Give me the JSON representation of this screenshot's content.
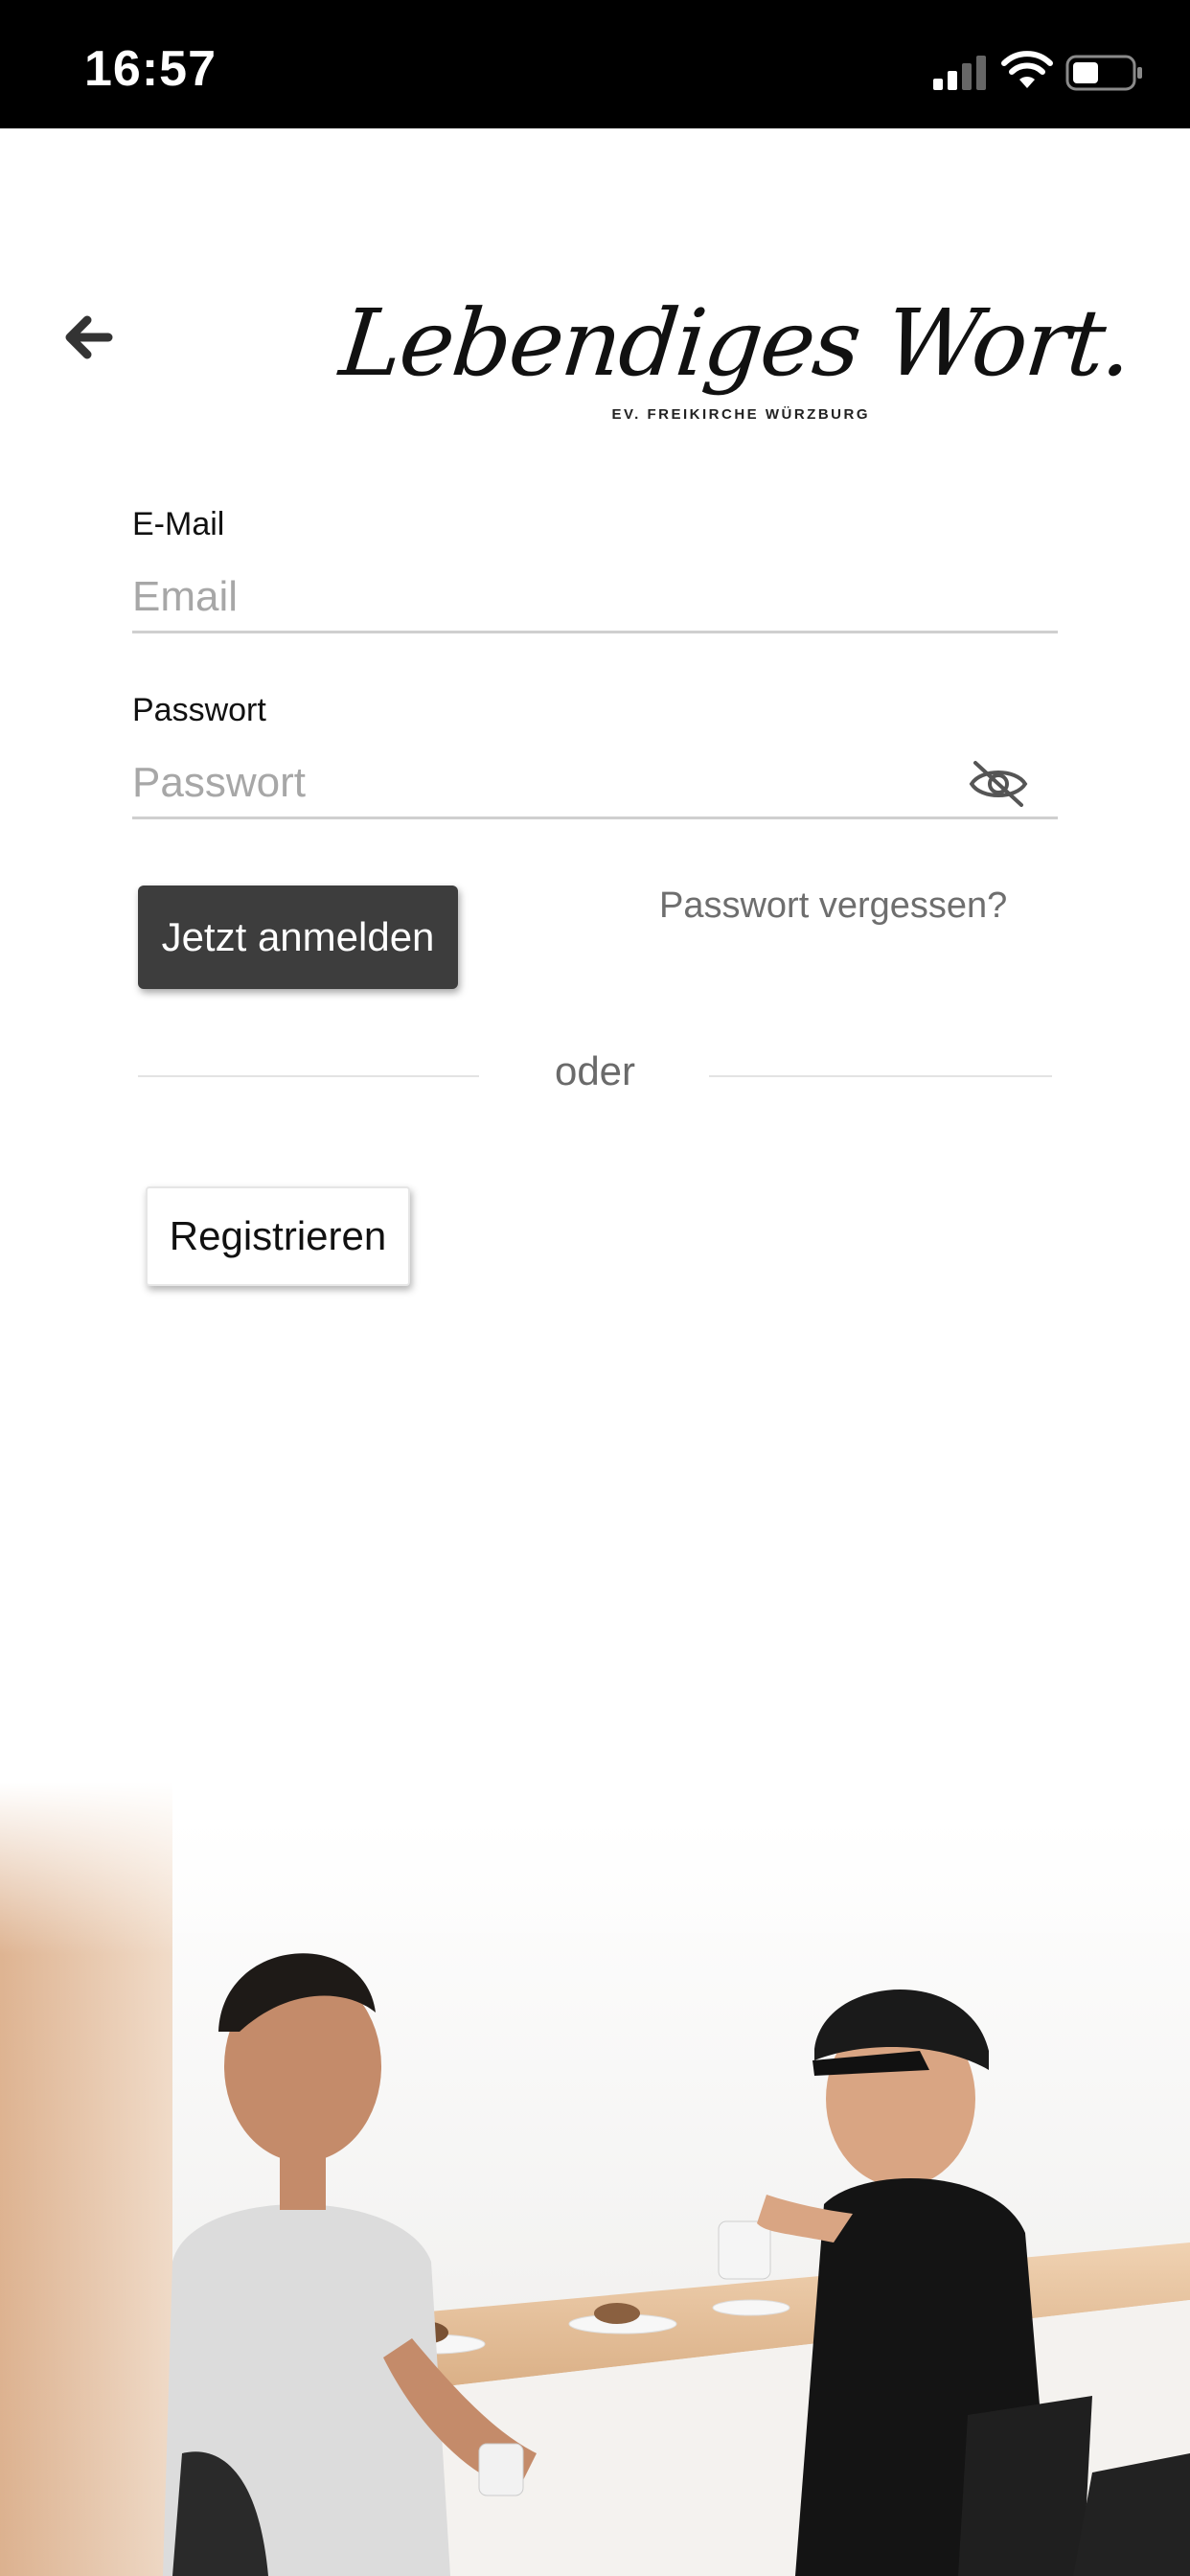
{
  "status_bar": {
    "time": "16:57"
  },
  "header": {
    "back_icon": "arrow-left-icon",
    "logo_text": "Lebendiges Wort.",
    "logo_subtitle": "EV. FREIKIRCHE WÜRZBURG"
  },
  "form": {
    "email": {
      "label": "E-Mail",
      "placeholder": "Email",
      "value": ""
    },
    "password": {
      "label": "Passwort",
      "placeholder": "Passwort",
      "value": "",
      "toggle_icon": "eye-off-icon"
    },
    "login_label": "Jetzt anmelden",
    "forgot_label": "Passwort vergessen?",
    "divider_label": "oder",
    "register_label": "Registrieren"
  },
  "colors": {
    "primary_button": "#3d3d3d",
    "muted_text": "#6e6e6e",
    "placeholder": "#a7a7a7"
  }
}
